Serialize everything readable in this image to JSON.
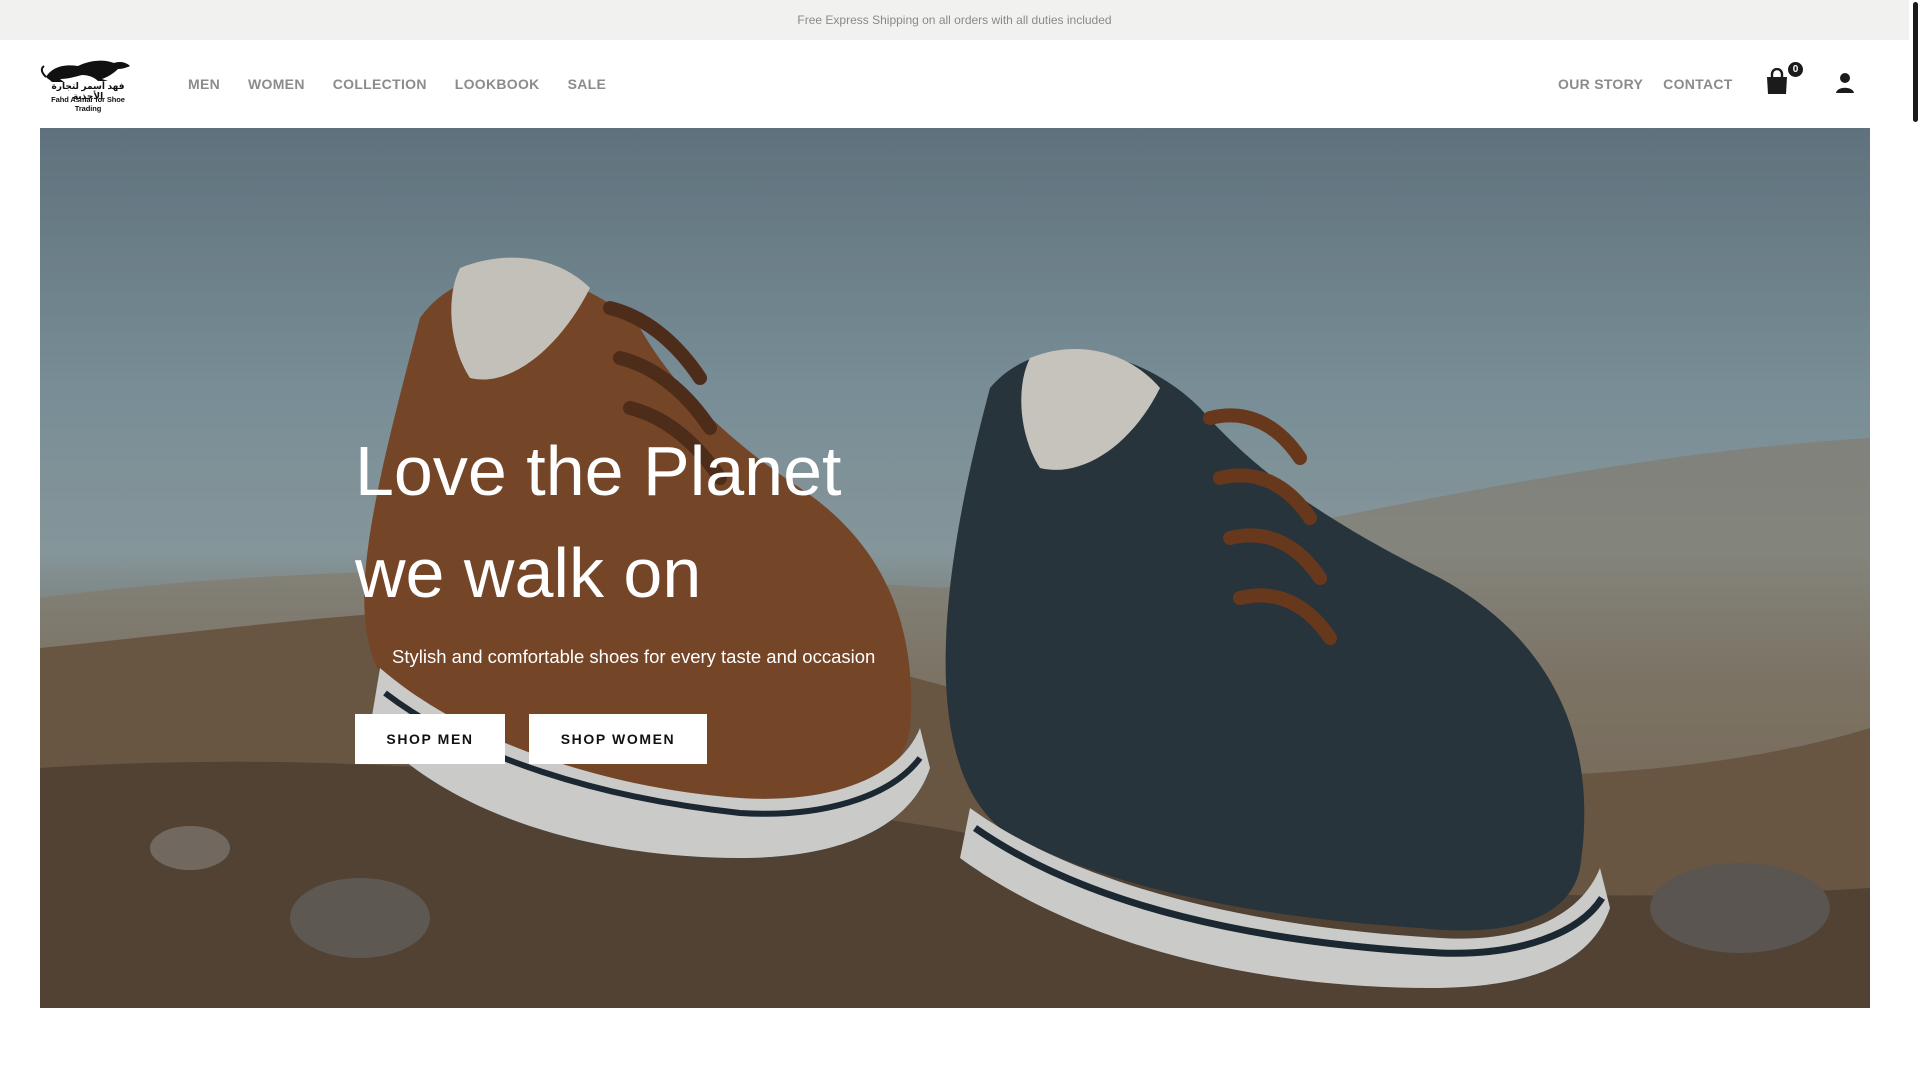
{
  "announcement": {
    "text": "Free Express Shipping on all orders with all duties included"
  },
  "brand": {
    "arabic_name": "فهد أسمر لتجارة الأحذية",
    "english_name": "Fahd Asmar for Shoe Trading",
    "logo_icon": "panther-icon"
  },
  "nav": {
    "left": [
      "MEN",
      "WOMEN",
      "COLLECTION",
      "LOOKBOOK",
      "SALE"
    ],
    "right": [
      "OUR STORY",
      "CONTACT"
    ]
  },
  "cart": {
    "icon": "shopping-bag-icon",
    "count": "0"
  },
  "account": {
    "icon": "user-icon"
  },
  "hero": {
    "title_line1": "Love the Planet",
    "title_line2": "we walk on",
    "subtitle": "Stylish and comfortable shoes for every taste and occasion",
    "buttons": {
      "men": "SHOP MEN",
      "women": "SHOP WOMEN"
    }
  },
  "colors": {
    "announcement_bg": "#f1f1f0",
    "nav_text": "#8b8b8b",
    "button_bg": "#ffffff",
    "badge_bg": "#1b1b1b"
  }
}
